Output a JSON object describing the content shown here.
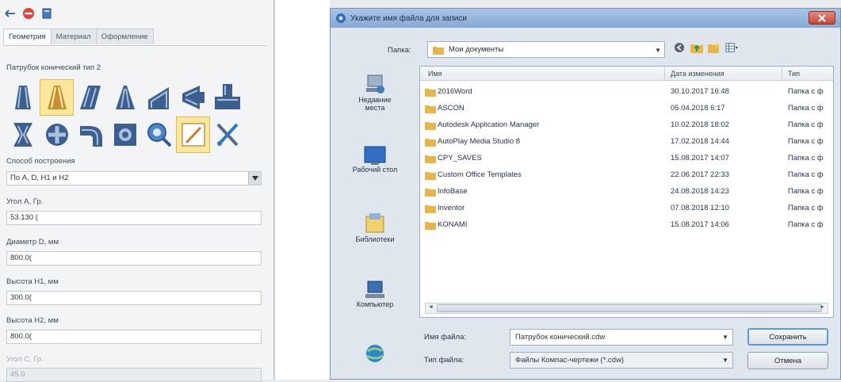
{
  "left_panel": {
    "tabs": [
      {
        "label": "Геометрия"
      },
      {
        "label": "Материал"
      },
      {
        "label": "Оформление"
      }
    ],
    "section_title": "Патрубок конический тип 2",
    "tiles": [
      {
        "name": "tile-straight-pipe-icon"
      },
      {
        "name": "tile-conical-pipe-icon",
        "selected": true
      },
      {
        "name": "tile-slanted-pipe-icon"
      },
      {
        "name": "tile-cone-icon"
      },
      {
        "name": "tile-wedge-icon"
      },
      {
        "name": "tile-side-cone-icon"
      },
      {
        "name": "tile-tee-icon"
      },
      {
        "name": "tile-double-cone-icon"
      },
      {
        "name": "tile-cross-icon"
      },
      {
        "name": "tile-elbow-icon"
      },
      {
        "name": "tile-square-round-icon"
      },
      {
        "name": "tile-search-icon"
      },
      {
        "name": "tile-pencil-icon"
      },
      {
        "name": "tile-tools-icon"
      }
    ],
    "fields": [
      {
        "label": "Способ построения",
        "value": "По A, D, H1 и H2",
        "type": "select"
      },
      {
        "label": "Угол A, Гр.",
        "value": "53.130 (",
        "type": "input"
      },
      {
        "label": "Диаметр D, мм",
        "value": "800.0(",
        "type": "input"
      },
      {
        "label": "Высота H1, мм",
        "value": "300.0(",
        "type": "input"
      },
      {
        "label": "Высота H2, мм",
        "value": "800.0(",
        "type": "input"
      },
      {
        "label": "Угол C, Гр.",
        "value": "45.0",
        "type": "input",
        "disabled": true
      }
    ]
  },
  "dialog": {
    "title": "Укажите имя файла для записи",
    "folder_label": "Папка:",
    "folder_value": "Мои документы",
    "places": [
      {
        "label": "Недавние места",
        "icon": "recent-places-icon"
      },
      {
        "label": "Рабочий стол",
        "icon": "desktop-icon"
      },
      {
        "label": "Библиотеки",
        "icon": "libraries-icon"
      },
      {
        "label": "Компьютер",
        "icon": "computer-icon"
      },
      {
        "label": "",
        "icon": "network-icon"
      }
    ],
    "columns": {
      "name": "Имя",
      "date": "Дата изменения",
      "type": "Тип"
    },
    "files": [
      {
        "name": "2016Word",
        "date": "30.10.2017 16:48",
        "type": "Папка с ф"
      },
      {
        "name": "ASCON",
        "date": "05.04.2018 6:17",
        "type": "Папка с ф"
      },
      {
        "name": "Autodesk Application Manager",
        "date": "10.02.2018 18:02",
        "type": "Папка с ф"
      },
      {
        "name": "AutoPlay Media Studio 8",
        "date": "17.02.2018 14:44",
        "type": "Папка с ф"
      },
      {
        "name": "CPY_SAVES",
        "date": "15.08.2017 14:07",
        "type": "Папка с ф"
      },
      {
        "name": "Custom Office Templates",
        "date": "22.06.2017 22:33",
        "type": "Папка с ф"
      },
      {
        "name": "InfoBase",
        "date": "24.08.2018 14:23",
        "type": "Папка с ф"
      },
      {
        "name": "Inventor",
        "date": "07.08.2018 12:10",
        "type": "Папка с ф"
      },
      {
        "name": "KONAMI",
        "date": "15.08.2017 14:06",
        "type": "Папка с ф"
      }
    ],
    "filename_label": "Имя файла:",
    "filename_value": "Патрубок конический.cdw",
    "filetype_label": "Тип файла:",
    "filetype_value": "Файлы Компас-чертежи (*.cdw)",
    "save_label": "Сохранить",
    "cancel_label": "Отмена"
  },
  "colors": {
    "accent": "#5a9bd6",
    "tile_blue": "#3d5f8f",
    "tile_selected": "#fde79a",
    "folder": "#e8b54a",
    "close": "#c8463a"
  }
}
